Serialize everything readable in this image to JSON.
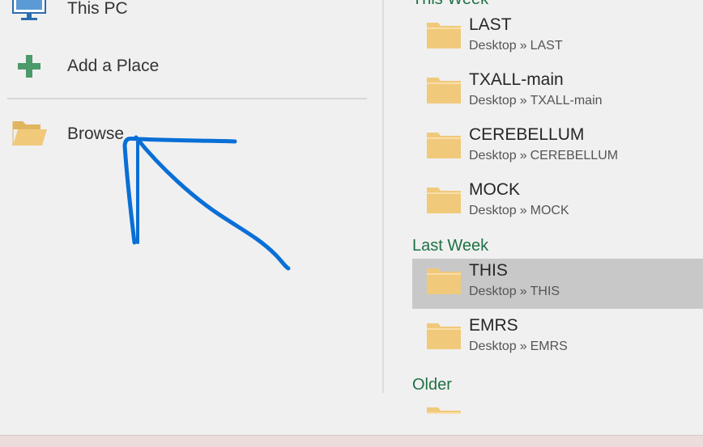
{
  "places": {
    "this_pc": {
      "label": "This PC",
      "icon": "computer-icon"
    },
    "add_place": {
      "label": "Add a Place",
      "icon": "plus-icon"
    },
    "browse": {
      "label": "Browse",
      "icon": "folder-open-icon"
    }
  },
  "recent": {
    "groups": [
      {
        "title": "This Week",
        "items": [
          {
            "name": "LAST",
            "path_root": "Desktop",
            "sep": "»",
            "path_leaf": "LAST"
          },
          {
            "name": "TXALL-main",
            "path_root": "Desktop",
            "sep": "»",
            "path_leaf": "TXALL-main"
          },
          {
            "name": "CEREBELLUM",
            "path_root": "Desktop",
            "sep": "»",
            "path_leaf": "CEREBELLUM"
          },
          {
            "name": "MOCK",
            "path_root": "Desktop",
            "sep": "»",
            "path_leaf": "MOCK"
          }
        ]
      },
      {
        "title": "Last Week",
        "items": [
          {
            "name": "THIS",
            "path_root": "Desktop",
            "sep": "»",
            "path_leaf": "THIS",
            "selected": true
          },
          {
            "name": "EMRS",
            "path_root": "Desktop",
            "sep": "»",
            "path_leaf": "EMRS"
          }
        ]
      },
      {
        "title": "Older",
        "items": []
      }
    ]
  },
  "colors": {
    "group_heading": "#1e7145",
    "folder": "#f0c97a",
    "selected_bg": "#c8c8c8",
    "annotation": "#0a6fd6",
    "plus": "#4c9a6a"
  },
  "annotation": {
    "icon": "arrow-annotation-icon"
  }
}
